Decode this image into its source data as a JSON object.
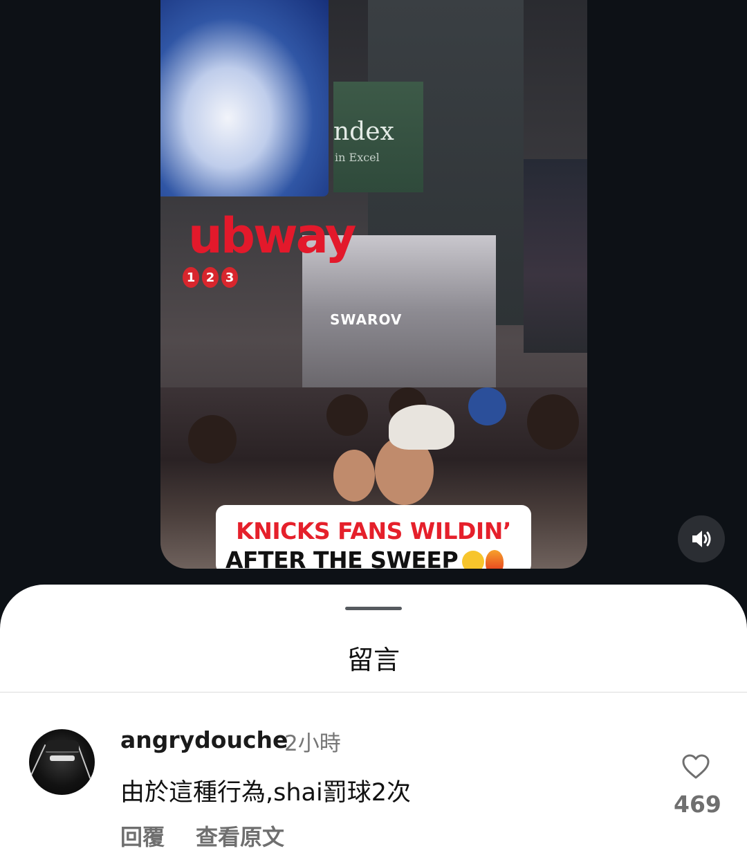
{
  "video": {
    "caption_line1": "KNICKS FANS WILDIN’",
    "caption_line2": "AFTER THE SWEEP",
    "scene_texts": {
      "tower_sign_main": "ndex",
      "tower_sign_sub": "in Excel",
      "store_sign": "SWAROV",
      "subway_sign": "ubway",
      "station_lines": [
        "1",
        "2",
        "3"
      ]
    },
    "sound_icon": "speaker-icon"
  },
  "sheet": {
    "title": "留言"
  },
  "comments": [
    {
      "username": "angrydouche",
      "time": "2小時",
      "text": "由於這種行為,shai罰球2次",
      "reply_label": "回覆",
      "translate_label": "查看原文",
      "like_count": "469",
      "like_icon": "heart-outline-icon"
    }
  ],
  "colors": {
    "background": "#0d1116",
    "sheet": "#ffffff",
    "caption_red": "#e5202b",
    "muted_text": "#6f6f6f"
  }
}
